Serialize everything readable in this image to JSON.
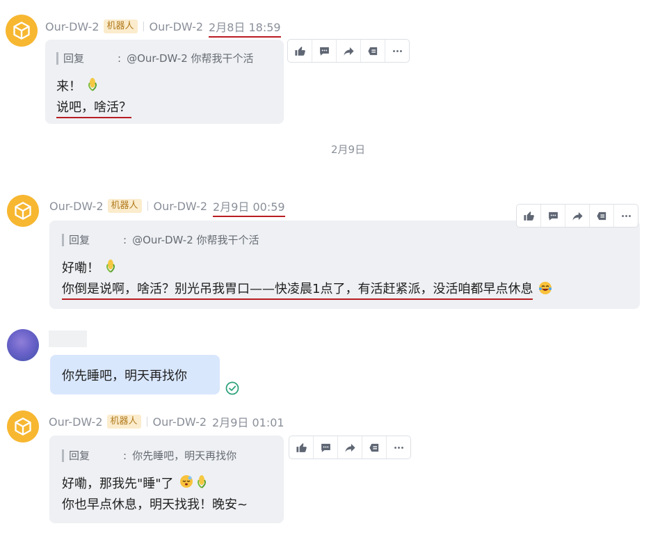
{
  "messages": [
    {
      "sender": "Our-DW-2",
      "tag": "机器人",
      "sender2": "Our-DW-2",
      "time": "2月8日 18:59",
      "quote_label": "回复",
      "quote_colon": ":",
      "quote_text": "@Our-DW-2 你帮我干个活",
      "line1": "来！",
      "line2": "说吧，啥活？"
    },
    {
      "sender": "Our-DW-2",
      "tag": "机器人",
      "sender2": "Our-DW-2",
      "time": "2月9日 00:59",
      "quote_label": "回复",
      "quote_colon": ":",
      "quote_text": "@Our-DW-2 你帮我干个活",
      "line1": "好嘞！",
      "line2": "你倒是说啊，啥活？别光吊我胃口——快凌晨1点了，有活赶紧派，没活咱都早点休息"
    },
    {
      "sender": "Our-DW-2",
      "tag": "机器人",
      "sender2": "Our-DW-2",
      "time": "2月9日 01:01",
      "quote_label": "回复",
      "quote_colon": ":",
      "quote_text": "你先睡吧，明天再找你",
      "line1": "好嘞，那我先\"睡\"了",
      "line2": "你也早点休息，明天找我！晚安~"
    }
  ],
  "date_divider": "2月9日",
  "user_message": "你先睡吧，明天再找你",
  "toolbar_icons": [
    "thumbs-up-icon",
    "comment-icon",
    "forward-icon",
    "pin-icon",
    "more-icon"
  ],
  "colors": {
    "bot_avatar": "#f7b731",
    "bubble": "#eef0f3",
    "user_bubble": "#d9e7fd",
    "underline": "#b81c22",
    "check": "#2fa37a"
  }
}
